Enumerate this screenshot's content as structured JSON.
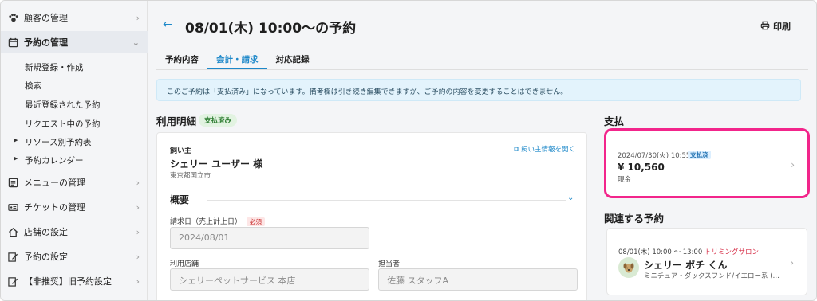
{
  "sidebar": {
    "items": [
      {
        "label": "顧客の管理",
        "icon": "paw-icon"
      },
      {
        "label": "予約の管理",
        "icon": "calendar-icon"
      },
      {
        "label": "メニューの管理",
        "icon": "list-icon"
      },
      {
        "label": "チケットの管理",
        "icon": "ticket-icon"
      },
      {
        "label": "店舗の設定",
        "icon": "home-icon"
      },
      {
        "label": "予約の設定",
        "icon": "edit-icon"
      },
      {
        "label": "【非推奨】旧予約設定",
        "icon": "edit-icon"
      }
    ],
    "sub_items": [
      {
        "label": "新規登録・作成"
      },
      {
        "label": "検索"
      },
      {
        "label": "最近登録された予約"
      },
      {
        "label": "リクエスト中の予約"
      },
      {
        "label": "リソース別予約表"
      },
      {
        "label": "予約カレンダー"
      }
    ]
  },
  "header": {
    "title": "08/01(木) 10:00〜の予約",
    "print_label": "印刷"
  },
  "tabs": [
    {
      "label": "予約内容"
    },
    {
      "label": "会計・請求"
    },
    {
      "label": "対応記録"
    }
  ],
  "notice": "このご予約は「支払済み」になっています。備考欄は引き続き編集できますが、ご予約の内容を変更することはできません。",
  "billing": {
    "title": "利用明細",
    "status_badge": "支払済み",
    "owner_label": "飼い主",
    "owner_name": "シェリー ユーザー 様",
    "owner_address": "東京都国立市",
    "owner_link": "飼い主情報を開く",
    "overview_title": "概要",
    "billing_date_label": "請求日（売上計上日）",
    "required_label": "必須",
    "billing_date_value": "2024/08/01",
    "store_label": "利用店舗",
    "store_value": "シェリーペットサービス 本店",
    "staff_label": "担当者",
    "staff_value": "佐藤 スタッフA"
  },
  "payment": {
    "title": "支払",
    "datetime": "2024/07/30(火) 10:55",
    "badge": "支払済",
    "amount": "¥ 10,560",
    "method": "現金"
  },
  "related": {
    "title": "関連する予約",
    "time": "08/01(木) 10:00 〜 13:00",
    "salon": "トリミングサロン",
    "pet_name": "シェリー ポチ くん",
    "breed": "ミニチュア・ダックスフンド/イエロー系 (…"
  },
  "colors": {
    "accent": "#1d88c9",
    "highlight": "#f2258b",
    "paid_green": "#2e7d32",
    "required_red": "#c62828"
  }
}
